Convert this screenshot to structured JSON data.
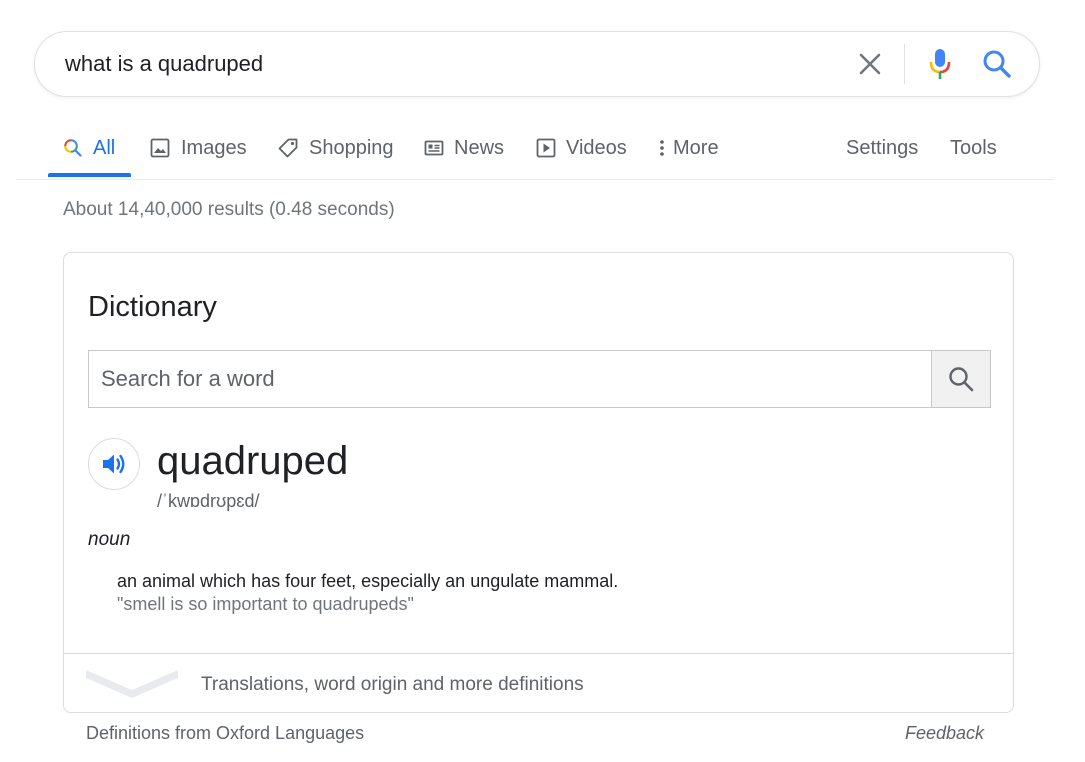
{
  "search": {
    "query": "what is a quadruped"
  },
  "tabs": [
    {
      "label": "All",
      "icon": "search-icon",
      "active": true
    },
    {
      "label": "Images",
      "icon": "image-icon"
    },
    {
      "label": "Shopping",
      "icon": "tag-icon"
    },
    {
      "label": "News",
      "icon": "newspaper-icon"
    },
    {
      "label": "Videos",
      "icon": "play-icon"
    },
    {
      "label": "More",
      "icon": "more-vert-icon"
    }
  ],
  "tools": {
    "settings": "Settings",
    "tools": "Tools"
  },
  "result_stats": "About 14,40,000 results (0.48 seconds)",
  "dictionary": {
    "title": "Dictionary",
    "search_placeholder": "Search for a word",
    "word": "quadruped",
    "phonetic": "/ˈkwɒdrʊpɛd/",
    "part_of_speech": "noun",
    "definition": "an animal which has four feet, especially an ungulate mammal.",
    "example": "\"smell is so important to quadrupeds\"",
    "more_label": "Translations, word origin and more definitions"
  },
  "footer": {
    "source": "Definitions from Oxford Languages",
    "feedback": "Feedback"
  },
  "colors": {
    "accent": "#1a73e8",
    "text": "#202124",
    "muted": "#5f6368",
    "border": "#dadce0"
  }
}
